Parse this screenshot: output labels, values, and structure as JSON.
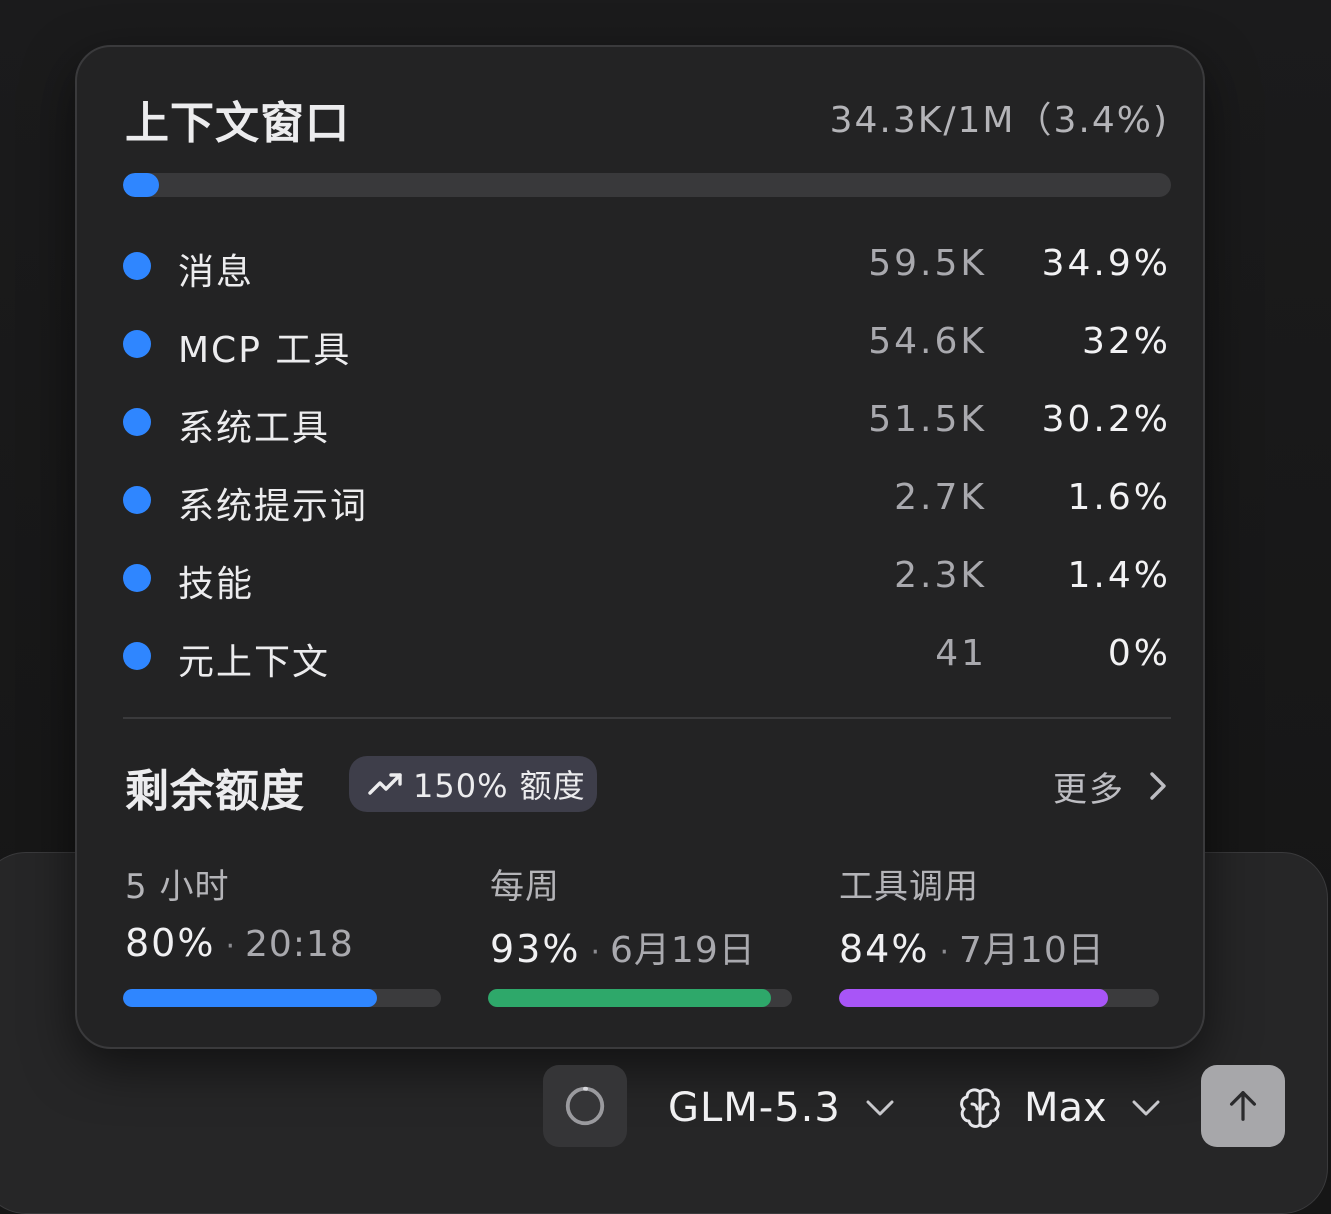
{
  "context": {
    "title": "上下文窗口",
    "usage": "34.3K/1M（3.4%)",
    "usage_fraction": 0.034,
    "accent": "#2f86ff",
    "items": [
      {
        "label": "消息",
        "tokens": "59.5K",
        "percent": "34.9%"
      },
      {
        "label": "MCP 工具",
        "tokens": "54.6K",
        "percent": "32%"
      },
      {
        "label": "系统工具",
        "tokens": "51.5K",
        "percent": "30.2%"
      },
      {
        "label": "系统提示词",
        "tokens": "2.7K",
        "percent": "1.6%"
      },
      {
        "label": "技能",
        "tokens": "2.3K",
        "percent": "1.4%"
      },
      {
        "label": "元上下文",
        "tokens": "41",
        "percent": "0%"
      }
    ]
  },
  "quota": {
    "title": "剩余额度",
    "badge": {
      "icon": "trending-up-icon",
      "label": "150% 额度"
    },
    "more_label": "更多",
    "more_icon": "chevron-right-icon",
    "limits": [
      {
        "name": "5 小时",
        "percent": "80%",
        "sep": "·",
        "reset": "20:18",
        "fill": 0.8,
        "color": "#2f86ff"
      },
      {
        "name": "每周",
        "percent": "93%",
        "sep": "·",
        "reset": "6月19日",
        "fill": 0.93,
        "color": "#2ea86a"
      },
      {
        "name": "工具调用",
        "percent": "84%",
        "sep": "·",
        "reset": "7月10日",
        "fill": 0.84,
        "color": "#a855f7"
      }
    ]
  },
  "toolbar": {
    "context_icon": "progress-ring-icon",
    "model": "GLM-5.3",
    "model_icon": "chevron-down-icon",
    "effort_icon": "brain-icon",
    "effort": "Max",
    "effort_chevron": "chevron-down-icon",
    "send_icon": "arrow-up-icon"
  }
}
